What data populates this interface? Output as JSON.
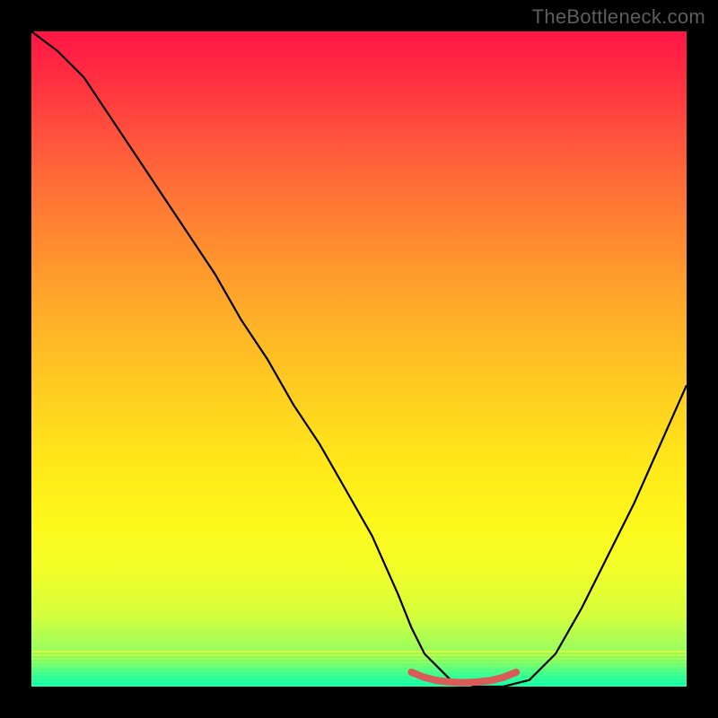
{
  "watermark": "TheBottleneck.com",
  "chart_data": {
    "type": "line",
    "title": "",
    "xlabel": "",
    "ylabel": "",
    "xlim": [
      0,
      100
    ],
    "ylim": [
      0,
      100
    ],
    "series": [
      {
        "name": "bottleneck-curve",
        "x": [
          0,
          4,
          8,
          12,
          16,
          20,
          24,
          28,
          32,
          36,
          40,
          44,
          48,
          52,
          56,
          58,
          60,
          64,
          68,
          70,
          72,
          76,
          80,
          84,
          88,
          92,
          96,
          100
        ],
        "y": [
          100,
          97,
          93,
          87,
          81,
          75,
          69,
          63,
          56,
          50,
          43,
          37,
          30,
          23,
          14,
          9,
          5,
          1,
          0,
          0,
          0,
          1,
          5,
          12,
          20,
          28,
          37,
          46
        ]
      },
      {
        "name": "optimal-zone-marker",
        "x": [
          58,
          60,
          62,
          64,
          66,
          68,
          70,
          72,
          74
        ],
        "y": [
          2.2,
          1.4,
          0.9,
          0.7,
          0.6,
          0.7,
          0.9,
          1.4,
          2.2
        ]
      }
    ],
    "gradient_stops": [
      {
        "pct": 0,
        "color": "#ff1546"
      },
      {
        "pct": 50,
        "color": "#ffd020"
      },
      {
        "pct": 85,
        "color": "#f2fd28"
      },
      {
        "pct": 100,
        "color": "#1cffa3"
      }
    ]
  }
}
